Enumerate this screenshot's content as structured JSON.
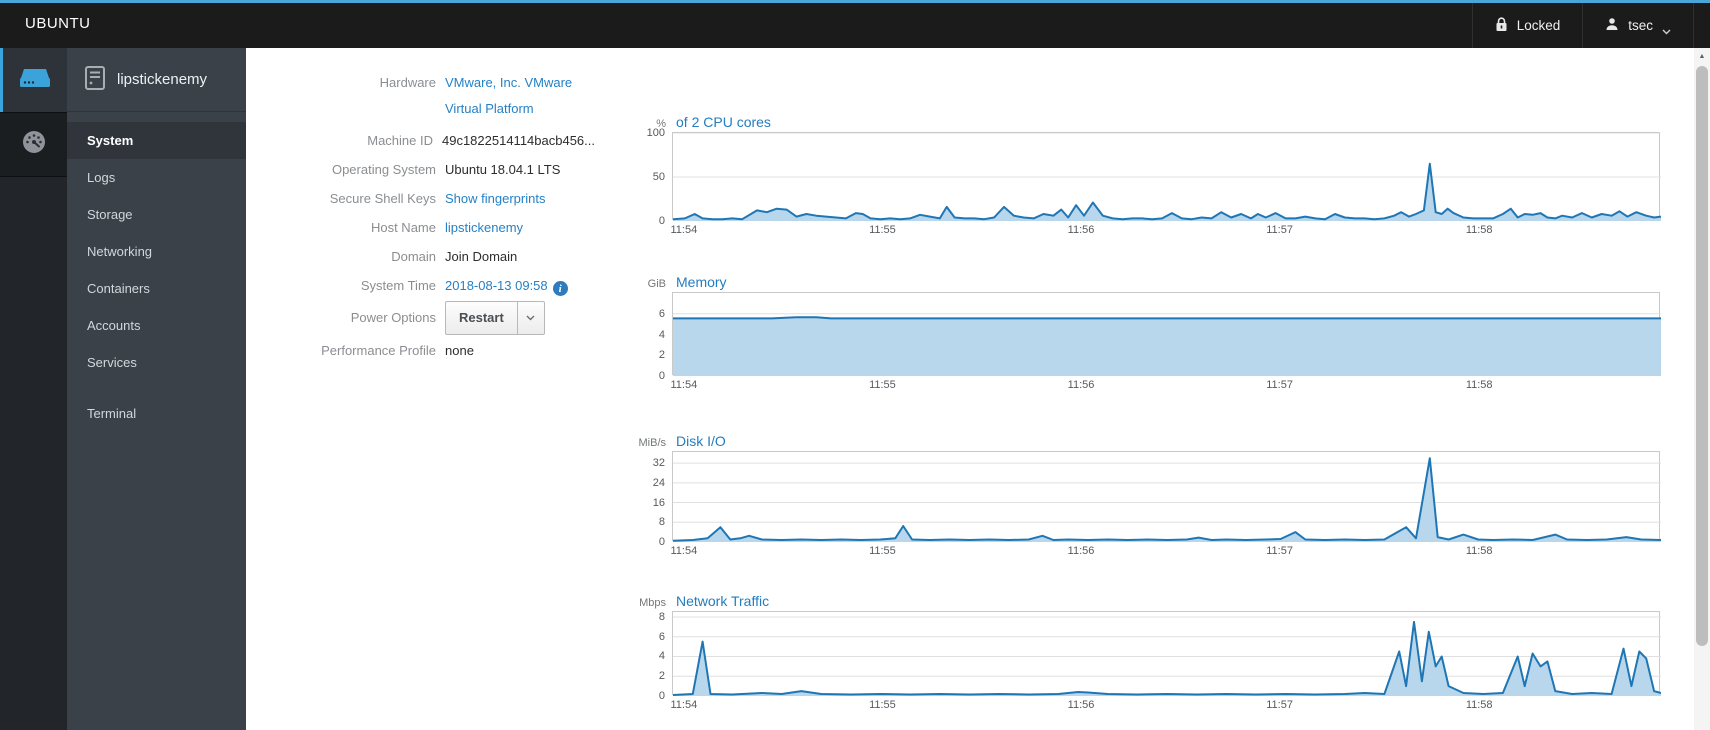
{
  "topnav": {
    "brand": "UBUNTU",
    "locked_label": "Locked",
    "user": "tsec"
  },
  "sidebar": {
    "host": "lipstickenemy",
    "items": [
      {
        "label": "System",
        "active": true
      },
      {
        "label": "Logs"
      },
      {
        "label": "Storage"
      },
      {
        "label": "Networking"
      },
      {
        "label": "Containers"
      },
      {
        "label": "Accounts"
      },
      {
        "label": "Services"
      },
      {
        "label": "Terminal",
        "separator_before": true
      }
    ]
  },
  "system_info": {
    "rows": [
      {
        "label": "Hardware",
        "value": "VMware, Inc. VMware Virtual Platform",
        "kind": "link",
        "wrap": true
      },
      {
        "label": "Machine ID",
        "value": "49c1822514114bacb456...",
        "kind": "text"
      },
      {
        "label": "Operating System",
        "value": "Ubuntu 18.04.1 LTS",
        "kind": "text"
      },
      {
        "label": "Secure Shell Keys",
        "value": "Show fingerprints",
        "kind": "link"
      },
      {
        "label": "Host Name",
        "value": "lipstickenemy",
        "kind": "link"
      },
      {
        "label": "Domain",
        "value": "Join Domain",
        "kind": "text"
      },
      {
        "label": "System Time",
        "value": "2018-08-13 09:58",
        "kind": "time"
      },
      {
        "label": "Power Options",
        "value": "Restart",
        "kind": "button"
      },
      {
        "label": "Performance Profile",
        "value": "none",
        "kind": "text"
      }
    ]
  },
  "chart_data": [
    {
      "type": "area",
      "unit": "%",
      "title": "of 2 CPU cores",
      "ylim": [
        0,
        100
      ],
      "yticks": [
        100,
        50,
        0
      ],
      "grid": true,
      "legend": "none",
      "x_ticks": [
        {
          "t": 0.012,
          "label": "11:54"
        },
        {
          "t": 0.213,
          "label": "11:55"
        },
        {
          "t": 0.414,
          "label": "11:56"
        },
        {
          "t": 0.615,
          "label": "11:57"
        },
        {
          "t": 0.817,
          "label": "11:58"
        }
      ],
      "points": [
        [
          0.0,
          2
        ],
        [
          0.012,
          3
        ],
        [
          0.022,
          8
        ],
        [
          0.03,
          3
        ],
        [
          0.04,
          2
        ],
        [
          0.05,
          2
        ],
        [
          0.06,
          3
        ],
        [
          0.07,
          2
        ],
        [
          0.085,
          12
        ],
        [
          0.095,
          10
        ],
        [
          0.105,
          14
        ],
        [
          0.115,
          13
        ],
        [
          0.125,
          5
        ],
        [
          0.135,
          8
        ],
        [
          0.145,
          6
        ],
        [
          0.155,
          5
        ],
        [
          0.165,
          4
        ],
        [
          0.175,
          3
        ],
        [
          0.185,
          9
        ],
        [
          0.192,
          8
        ],
        [
          0.2,
          3
        ],
        [
          0.21,
          2
        ],
        [
          0.22,
          3
        ],
        [
          0.23,
          2
        ],
        [
          0.24,
          3
        ],
        [
          0.25,
          7
        ],
        [
          0.26,
          5
        ],
        [
          0.27,
          3
        ],
        [
          0.277,
          16
        ],
        [
          0.285,
          4
        ],
        [
          0.295,
          3
        ],
        [
          0.305,
          3
        ],
        [
          0.315,
          2
        ],
        [
          0.325,
          4
        ],
        [
          0.335,
          16
        ],
        [
          0.345,
          6
        ],
        [
          0.355,
          4
        ],
        [
          0.365,
          3
        ],
        [
          0.375,
          8
        ],
        [
          0.385,
          6
        ],
        [
          0.393,
          13
        ],
        [
          0.4,
          4
        ],
        [
          0.408,
          18
        ],
        [
          0.416,
          6
        ],
        [
          0.425,
          21
        ],
        [
          0.435,
          6
        ],
        [
          0.445,
          3
        ],
        [
          0.455,
          2
        ],
        [
          0.465,
          3
        ],
        [
          0.475,
          3
        ],
        [
          0.485,
          2
        ],
        [
          0.495,
          3
        ],
        [
          0.505,
          9
        ],
        [
          0.515,
          3
        ],
        [
          0.525,
          2
        ],
        [
          0.535,
          4
        ],
        [
          0.545,
          3
        ],
        [
          0.555,
          10
        ],
        [
          0.565,
          4
        ],
        [
          0.575,
          8
        ],
        [
          0.585,
          3
        ],
        [
          0.592,
          8
        ],
        [
          0.6,
          4
        ],
        [
          0.61,
          9
        ],
        [
          0.62,
          3
        ],
        [
          0.63,
          3
        ],
        [
          0.64,
          5
        ],
        [
          0.65,
          3
        ],
        [
          0.66,
          2
        ],
        [
          0.67,
          8
        ],
        [
          0.68,
          4
        ],
        [
          0.69,
          3
        ],
        [
          0.7,
          3
        ],
        [
          0.71,
          2
        ],
        [
          0.72,
          3
        ],
        [
          0.73,
          6
        ],
        [
          0.737,
          10
        ],
        [
          0.745,
          5
        ],
        [
          0.752,
          8
        ],
        [
          0.76,
          12
        ],
        [
          0.766,
          65
        ],
        [
          0.772,
          10
        ],
        [
          0.778,
          8
        ],
        [
          0.784,
          14
        ],
        [
          0.79,
          9
        ],
        [
          0.8,
          4
        ],
        [
          0.81,
          3
        ],
        [
          0.82,
          3
        ],
        [
          0.83,
          3
        ],
        [
          0.84,
          8
        ],
        [
          0.848,
          14
        ],
        [
          0.855,
          4
        ],
        [
          0.862,
          8
        ],
        [
          0.87,
          7
        ],
        [
          0.878,
          9
        ],
        [
          0.885,
          4
        ],
        [
          0.893,
          3
        ],
        [
          0.9,
          6
        ],
        [
          0.91,
          4
        ],
        [
          0.92,
          9
        ],
        [
          0.93,
          4
        ],
        [
          0.94,
          8
        ],
        [
          0.95,
          6
        ],
        [
          0.958,
          11
        ],
        [
          0.966,
          5
        ],
        [
          0.975,
          10
        ],
        [
          0.985,
          6
        ],
        [
          0.993,
          4
        ],
        [
          1.0,
          5
        ]
      ]
    },
    {
      "type": "area",
      "unit": "GiB",
      "title": "Memory",
      "ylim": [
        0,
        8
      ],
      "yticks": [
        6,
        4,
        2,
        0
      ],
      "grid": true,
      "legend": "none",
      "x_ticks": [
        {
          "t": 0.012,
          "label": "11:54"
        },
        {
          "t": 0.213,
          "label": "11:55"
        },
        {
          "t": 0.414,
          "label": "11:56"
        },
        {
          "t": 0.615,
          "label": "11:57"
        },
        {
          "t": 0.817,
          "label": "11:58"
        }
      ],
      "points": [
        [
          0.0,
          5.55
        ],
        [
          0.1,
          5.55
        ],
        [
          0.125,
          5.67
        ],
        [
          0.145,
          5.67
        ],
        [
          0.16,
          5.55
        ],
        [
          0.5,
          5.55
        ],
        [
          1.0,
          5.55
        ]
      ]
    },
    {
      "type": "area",
      "unit": "MiB/s",
      "title": "Disk I/O",
      "ylim": [
        0,
        36.5
      ],
      "yticks": [
        32,
        24,
        16,
        8,
        0
      ],
      "grid": true,
      "legend": "none",
      "x_ticks": [
        {
          "t": 0.012,
          "label": "11:54"
        },
        {
          "t": 0.213,
          "label": "11:55"
        },
        {
          "t": 0.414,
          "label": "11:56"
        },
        {
          "t": 0.615,
          "label": "11:57"
        },
        {
          "t": 0.817,
          "label": "11:58"
        }
      ],
      "points": [
        [
          0.0,
          0.5
        ],
        [
          0.02,
          0.8
        ],
        [
          0.035,
          1.5
        ],
        [
          0.048,
          6
        ],
        [
          0.058,
          1
        ],
        [
          0.068,
          1.5
        ],
        [
          0.077,
          2.5
        ],
        [
          0.09,
          1
        ],
        [
          0.11,
          0.8
        ],
        [
          0.13,
          1
        ],
        [
          0.15,
          0.8
        ],
        [
          0.17,
          1
        ],
        [
          0.19,
          0.8
        ],
        [
          0.21,
          1
        ],
        [
          0.225,
          1.5
        ],
        [
          0.233,
          6.5
        ],
        [
          0.242,
          1
        ],
        [
          0.26,
          0.8
        ],
        [
          0.28,
          1
        ],
        [
          0.3,
          0.8
        ],
        [
          0.32,
          1
        ],
        [
          0.34,
          0.8
        ],
        [
          0.36,
          1
        ],
        [
          0.374,
          2.5
        ],
        [
          0.385,
          0.8
        ],
        [
          0.4,
          1
        ],
        [
          0.42,
          0.8
        ],
        [
          0.44,
          1
        ],
        [
          0.46,
          0.8
        ],
        [
          0.48,
          1
        ],
        [
          0.5,
          0.8
        ],
        [
          0.52,
          1
        ],
        [
          0.532,
          1.8
        ],
        [
          0.545,
          0.8
        ],
        [
          0.56,
          1
        ],
        [
          0.58,
          0.8
        ],
        [
          0.6,
          1
        ],
        [
          0.615,
          1.2
        ],
        [
          0.63,
          4
        ],
        [
          0.64,
          1
        ],
        [
          0.66,
          0.8
        ],
        [
          0.68,
          1
        ],
        [
          0.7,
          0.8
        ],
        [
          0.72,
          1
        ],
        [
          0.742,
          6
        ],
        [
          0.752,
          1.5
        ],
        [
          0.766,
          34
        ],
        [
          0.774,
          2
        ],
        [
          0.785,
          1
        ],
        [
          0.8,
          3
        ],
        [
          0.815,
          1
        ],
        [
          0.83,
          0.8
        ],
        [
          0.85,
          1
        ],
        [
          0.87,
          0.8
        ],
        [
          0.893,
          3
        ],
        [
          0.905,
          1
        ],
        [
          0.925,
          0.8
        ],
        [
          0.945,
          1
        ],
        [
          0.965,
          2
        ],
        [
          0.98,
          1
        ],
        [
          1.0,
          0.8
        ]
      ]
    },
    {
      "type": "area",
      "unit": "Mbps",
      "title": "Network Traffic",
      "ylim": [
        0,
        8.5
      ],
      "yticks": [
        8,
        6,
        4,
        2,
        0
      ],
      "grid": true,
      "legend": "none",
      "x_ticks": [
        {
          "t": 0.012,
          "label": "11:54"
        },
        {
          "t": 0.213,
          "label": "11:55"
        },
        {
          "t": 0.414,
          "label": "11:56"
        },
        {
          "t": 0.615,
          "label": "11:57"
        },
        {
          "t": 0.817,
          "label": "11:58"
        }
      ],
      "points": [
        [
          0.0,
          0.1
        ],
        [
          0.02,
          0.2
        ],
        [
          0.03,
          5.5
        ],
        [
          0.038,
          0.2
        ],
        [
          0.06,
          0.15
        ],
        [
          0.09,
          0.3
        ],
        [
          0.11,
          0.2
        ],
        [
          0.13,
          0.5
        ],
        [
          0.15,
          0.2
        ],
        [
          0.18,
          0.15
        ],
        [
          0.21,
          0.2
        ],
        [
          0.24,
          0.15
        ],
        [
          0.27,
          0.2
        ],
        [
          0.3,
          0.15
        ],
        [
          0.33,
          0.2
        ],
        [
          0.36,
          0.15
        ],
        [
          0.39,
          0.2
        ],
        [
          0.41,
          0.4
        ],
        [
          0.42,
          0.35
        ],
        [
          0.44,
          0.2
        ],
        [
          0.47,
          0.15
        ],
        [
          0.5,
          0.2
        ],
        [
          0.53,
          0.15
        ],
        [
          0.56,
          0.2
        ],
        [
          0.59,
          0.15
        ],
        [
          0.62,
          0.2
        ],
        [
          0.65,
          0.15
        ],
        [
          0.68,
          0.2
        ],
        [
          0.7,
          0.3
        ],
        [
          0.72,
          0.2
        ],
        [
          0.735,
          4.5
        ],
        [
          0.742,
          1
        ],
        [
          0.75,
          7.5
        ],
        [
          0.758,
          1.5
        ],
        [
          0.765,
          6.5
        ],
        [
          0.772,
          3
        ],
        [
          0.778,
          4
        ],
        [
          0.785,
          1
        ],
        [
          0.8,
          0.3
        ],
        [
          0.82,
          0.2
        ],
        [
          0.84,
          0.3
        ],
        [
          0.855,
          4
        ],
        [
          0.862,
          1
        ],
        [
          0.87,
          4.3
        ],
        [
          0.878,
          3
        ],
        [
          0.885,
          3.5
        ],
        [
          0.893,
          0.5
        ],
        [
          0.91,
          0.2
        ],
        [
          0.93,
          0.3
        ],
        [
          0.95,
          0.2
        ],
        [
          0.962,
          4.8
        ],
        [
          0.97,
          1
        ],
        [
          0.978,
          4.5
        ],
        [
          0.985,
          3.8
        ],
        [
          0.993,
          0.5
        ],
        [
          1.0,
          0.3
        ]
      ]
    }
  ],
  "colors": {
    "accent": "#39a5dc",
    "navbar_bg": "#1b1b1b",
    "link": "#2581c6",
    "series_line": "#1f76b4",
    "series_fill": "#b9d7ec",
    "grid_line": "#e0e0e0"
  }
}
